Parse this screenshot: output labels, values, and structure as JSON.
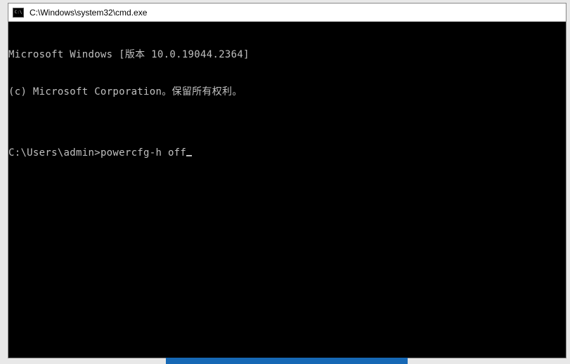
{
  "titlebar": {
    "path": "C:\\Windows\\system32\\cmd.exe"
  },
  "terminal": {
    "line1": "Microsoft Windows [版本 10.0.19044.2364]",
    "line2": "(c) Microsoft Corporation。保留所有权利。",
    "blank": "",
    "prompt": "C:\\Users\\admin>",
    "command": "powercfg-h off"
  }
}
